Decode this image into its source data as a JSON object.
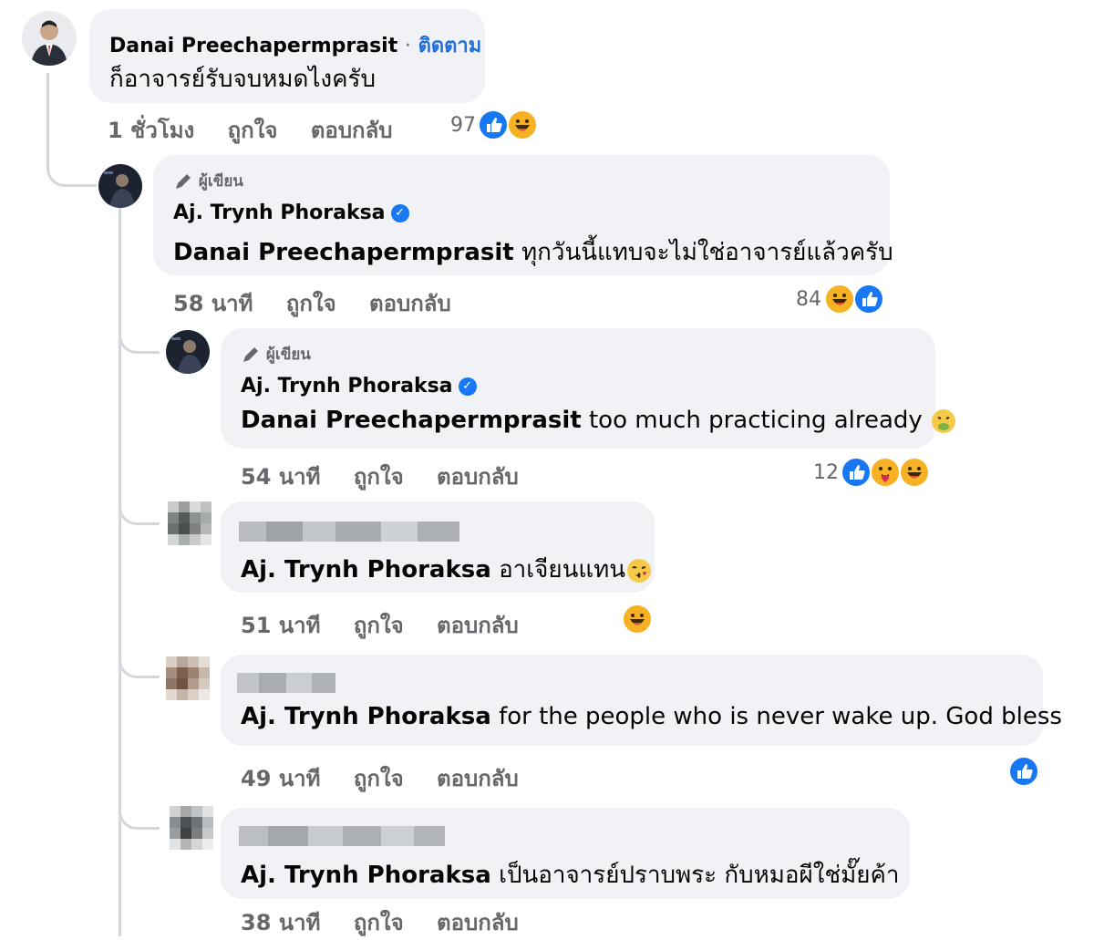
{
  "comments": [
    {
      "author": "Danai Preechapermprasit",
      "follow_label": "ติดตาม",
      "separator": "·",
      "text": "ก็อาจารย์รับจบหมดไงครับ",
      "time": "1 ชั่วโมง",
      "like_label": "ถูกใจ",
      "reply_label": "ตอบกลับ",
      "reaction_count": "97",
      "reactions": [
        "like-icon",
        "laugh-icon"
      ]
    },
    {
      "author_tag": "ผู้เขียน",
      "author": "Aj. Trynh Phoraksa",
      "mention": "Danai Preechapermprasit",
      "text": "ทุกวันนี้แทบจะไม่ใช่อาจารย์แล้วครับ",
      "time": "58 นาที",
      "like_label": "ถูกใจ",
      "reply_label": "ตอบกลับ",
      "reaction_count": "84",
      "reactions": [
        "laugh-icon",
        "like-icon"
      ]
    },
    {
      "author_tag": "ผู้เขียน",
      "author": "Aj. Trynh Phoraksa",
      "mention": "Danai Preechapermprasit",
      "text": "too much practicing already",
      "time": "54 นาที",
      "like_label": "ถูกใจ",
      "reply_label": "ตอบกลับ",
      "reaction_count": "12",
      "reactions": [
        "like-icon",
        "care-icon",
        "laugh-icon"
      ]
    },
    {
      "mention": "Aj. Trynh Phoraksa",
      "text": "อาเจียนแทน",
      "time": "51 นาที",
      "like_label": "ถูกใจ",
      "reply_label": "ตอบกลับ",
      "reactions": [
        "laugh-icon"
      ]
    },
    {
      "mention": "Aj. Trynh Phoraksa",
      "text": "for the people who is never wake up. God bless",
      "time": "49 นาที",
      "like_label": "ถูกใจ",
      "reply_label": "ตอบกลับ",
      "reactions": [
        "like-icon"
      ]
    },
    {
      "mention": "Aj. Trynh Phoraksa",
      "text": "เป็นอาจารย์ปราบพระ กับหมอผีใช่มั๊ยค้า",
      "time": "38 นาที",
      "like_label": "ถูกใจ",
      "reply_label": "ตอบกลับ",
      "reactions": []
    }
  ],
  "colors": {
    "bubble": "#f0f2f5",
    "link_blue": "#216fdb",
    "meta_gray": "#65676b",
    "like_blue": "#1877f2",
    "laugh_yellow": "#f7b125"
  }
}
